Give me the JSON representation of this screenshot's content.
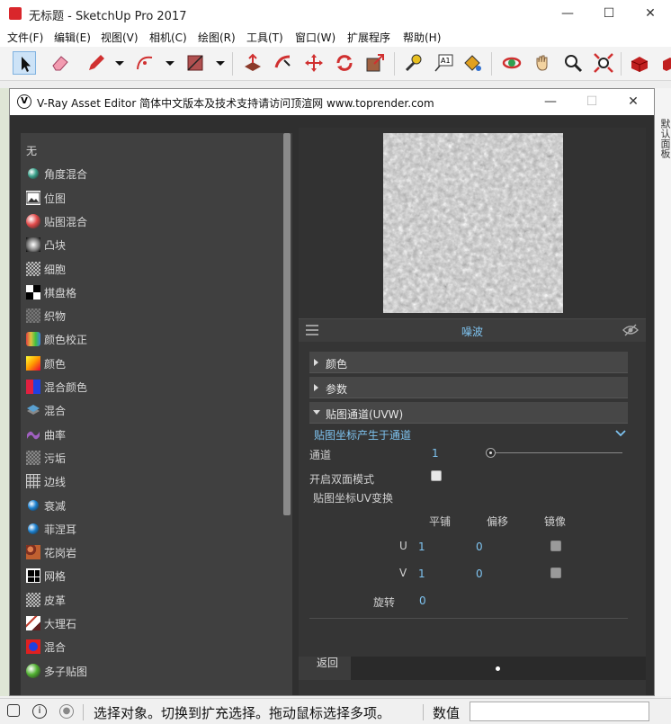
{
  "app": {
    "title": "无标题 - SketchUp Pro 2017",
    "window_controls": [
      "—",
      "☐",
      "✕"
    ]
  },
  "menu": [
    "文件(F)",
    "编辑(E)",
    "视图(V)",
    "相机(C)",
    "绘图(R)",
    "工具(T)",
    "窗口(W)",
    "扩展程序",
    "帮助(H)"
  ],
  "toolbar": {
    "tools": [
      "select-icon",
      "eraser-icon",
      "pencil-icon",
      "arc-icon",
      "rectangle-icon",
      "push-pull-icon",
      "follow-me-icon",
      "move-icon",
      "rotate-icon",
      "scale-icon",
      "tape-measure-icon",
      "text-icon",
      "paint-bucket-icon",
      "orbit-icon",
      "pan-icon",
      "zoom-icon",
      "zoom-extents-icon",
      "warehouse-icon",
      "extension-icon"
    ],
    "text_tool_label": "A1"
  },
  "right_strip_text": "默认面板",
  "vray": {
    "title": "V-Ray Asset Editor 简体中文版本及技术支持请访问顶渲网 www.toprender.com",
    "logo": "V",
    "controls": [
      "—",
      "☐",
      "✕"
    ],
    "texture_list": [
      {
        "label": "无",
        "icon": "none"
      },
      {
        "label": "角度混合",
        "icon": "falloff-icon",
        "color": "#3aa08a"
      },
      {
        "label": "位图",
        "icon": "bitmap-icon",
        "color": "#e0e0e0"
      },
      {
        "label": "贴图混合",
        "icon": "mix-map-icon",
        "color": "#e04a4a"
      },
      {
        "label": "凸块",
        "icon": "bump-icon",
        "color": "#ffffff"
      },
      {
        "label": "细胞",
        "icon": "cellular-icon",
        "color": "#bbbbbb"
      },
      {
        "label": "棋盘格",
        "icon": "checker-icon",
        "color": "#000000"
      },
      {
        "label": "织物",
        "icon": "fabric-icon",
        "color": "#777777"
      },
      {
        "label": "颜色校正",
        "icon": "color-correct-icon",
        "color": "#d0a060"
      },
      {
        "label": "颜色",
        "icon": "color-icon",
        "color": "#f0b000"
      },
      {
        "label": "混合颜色",
        "icon": "blend-color-icon",
        "color": "#cc2244"
      },
      {
        "label": "混合",
        "icon": "blend-icon",
        "color": "#5aa0d0"
      },
      {
        "label": "曲率",
        "icon": "curvature-icon",
        "color": "#a060c0"
      },
      {
        "label": "污垢",
        "icon": "dirt-icon",
        "color": "#888888"
      },
      {
        "label": "边线",
        "icon": "edges-icon",
        "color": "#aaaaaa"
      },
      {
        "label": "衰减",
        "icon": "falloff2-icon",
        "color": "#1a80d0"
      },
      {
        "label": "菲涅耳",
        "icon": "fresnel-icon",
        "color": "#1a80d0"
      },
      {
        "label": "花岗岩",
        "icon": "granite-icon",
        "color": "#b06030"
      },
      {
        "label": "网格",
        "icon": "grid-icon",
        "color": "#000000"
      },
      {
        "label": "皮革",
        "icon": "leather-icon",
        "color": "#bbbbbb"
      },
      {
        "label": "大理石",
        "icon": "marble-icon",
        "color": "#c04030"
      },
      {
        "label": "混合",
        "icon": "mix-icon",
        "color": "#2040e0"
      },
      {
        "label": "多子贴图",
        "icon": "multi-sub-icon",
        "color": "#50b030"
      }
    ],
    "editor": {
      "texture_name": "噪波",
      "sections": [
        {
          "label": "颜色",
          "expanded": false
        },
        {
          "label": "参数",
          "expanded": false
        },
        {
          "label": "贴图通道(UVW)",
          "expanded": true
        }
      ],
      "uvw": {
        "mode_label": "贴图坐标产生于通道",
        "channel_label": "通道",
        "channel_value": "1",
        "channel_slider": 0.05,
        "double_sided_label": "开启双面模式",
        "uv_transform_label": "贴图坐标UV变换",
        "columns": [
          "平铺",
          "偏移",
          "镜像"
        ],
        "rows": [
          {
            "axis": "U",
            "tile": "1",
            "offset": "0"
          },
          {
            "axis": "V",
            "tile": "1",
            "offset": "0"
          }
        ],
        "rotate_label": "旋转",
        "rotate_value": "0"
      },
      "back_label": "返回"
    }
  },
  "status": {
    "text": "选择对象。切换到扩充选择。拖动鼠标选择多项。",
    "value_label": "数值",
    "icons": [
      "info-icon",
      "user-icon"
    ]
  }
}
